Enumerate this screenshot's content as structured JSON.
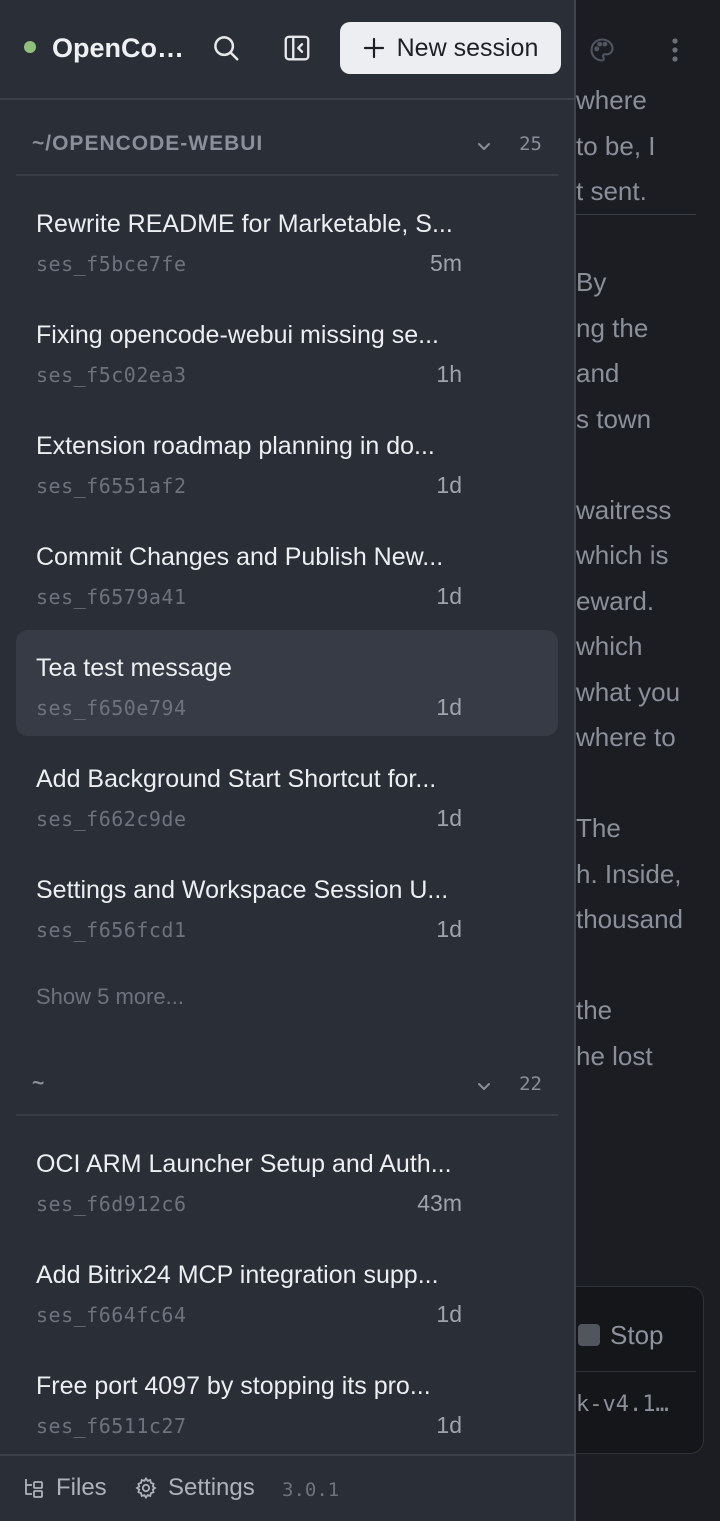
{
  "sidebar": {
    "status_color": "#8fbf7a",
    "app_title": "OpenCo…",
    "new_session_label": "New session",
    "groups": [
      {
        "title": "~/OPENCODE-WEBUI",
        "count": "25",
        "sessions": [
          {
            "title": "Rewrite README for Marketable, S...",
            "id": "ses_f5bce7fe",
            "time": "5m"
          },
          {
            "title": "Fixing opencode-webui missing se...",
            "id": "ses_f5c02ea3",
            "time": "1h"
          },
          {
            "title": "Extension roadmap planning in do...",
            "id": "ses_f6551af2",
            "time": "1d"
          },
          {
            "title": "Commit Changes and Publish New...",
            "id": "ses_f6579a41",
            "time": "1d"
          },
          {
            "title": "Tea test message",
            "id": "ses_f650e794",
            "time": "1d"
          },
          {
            "title": "Add Background Start Shortcut for...",
            "id": "ses_f662c9de",
            "time": "1d"
          },
          {
            "title": "Settings and Workspace Session U...",
            "id": "ses_f656fcd1",
            "time": "1d"
          }
        ],
        "show_more": "Show 5 more..."
      },
      {
        "title": "~",
        "count": "22",
        "sessions": [
          {
            "title": "OCI ARM Launcher Setup and Auth...",
            "id": "ses_f6d912c6",
            "time": "43m"
          },
          {
            "title": "Add Bitrix24 MCP integration supp...",
            "id": "ses_f664fc64",
            "time": "1d"
          },
          {
            "title": "Free port 4097 by stopping its pro...",
            "id": "ses_f6511c27",
            "time": "1d"
          }
        ]
      }
    ],
    "footer": {
      "files_label": "Files",
      "settings_label": "Settings",
      "version": "3.0.1"
    }
  },
  "main": {
    "text_lines": [
      "where",
      "to be, I",
      "t sent.",
      "",
      "By",
      "ng the",
      "and",
      "s town",
      "",
      "waitress",
      "which is",
      "eward.",
      "which",
      "what you",
      "where to",
      "",
      "The",
      "h. Inside,",
      "thousand",
      "",
      "the",
      "he lost"
    ],
    "stop_label": "Stop",
    "model_text": "k-v4.1…"
  }
}
